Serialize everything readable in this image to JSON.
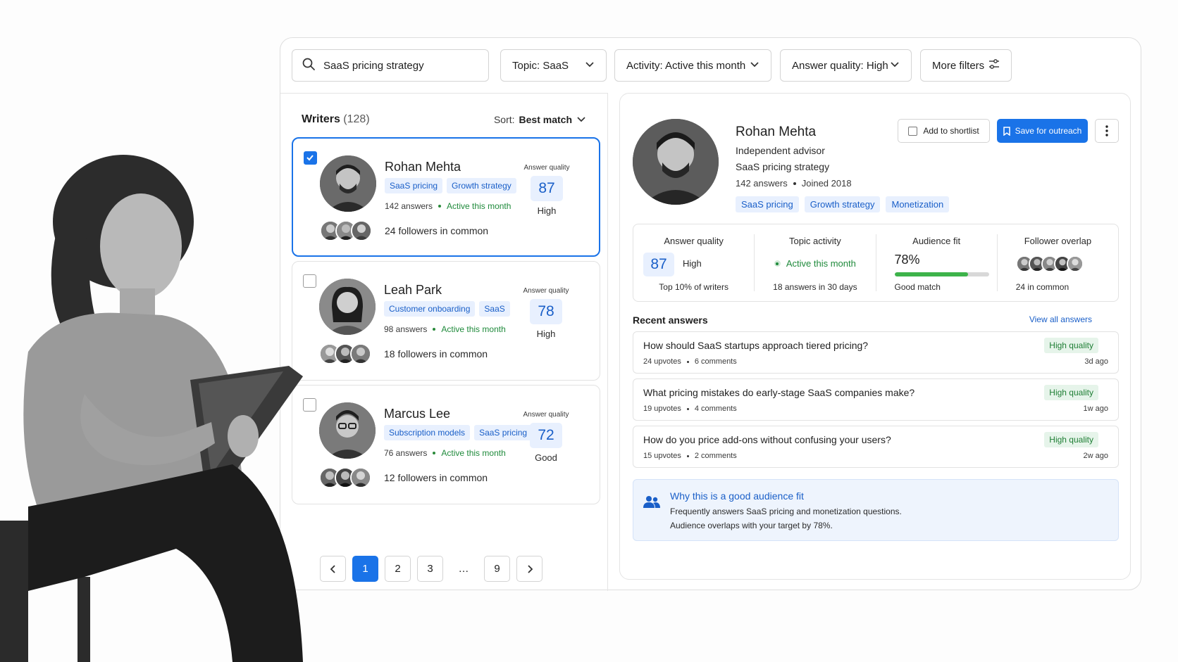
{
  "search": {
    "value": "SaaS pricing strategy"
  },
  "filters": [
    {
      "label": "Topic: SaaS"
    },
    {
      "label": "Activity: Active this month"
    },
    {
      "label": "Answer quality: High"
    },
    {
      "label": "More filters"
    }
  ],
  "writers": {
    "title": "Writers",
    "count": "(128)",
    "sort_prefix": "Sort:",
    "sort_value": "Best match",
    "cards": [
      {
        "name": "Rohan Mehta",
        "tags": [
          "SaaS pricing",
          "Growth strategy"
        ],
        "answers": "142 answers",
        "activity": "Active this month",
        "followers": "24 followers in common",
        "aq_label": "Answer quality",
        "aq_score": "87",
        "aq_level": "High",
        "selected": true
      },
      {
        "name": "Leah Park",
        "tags": [
          "Customer onboarding",
          "SaaS"
        ],
        "answers": "98 answers",
        "activity": "Active this month",
        "followers": "18  followers in common",
        "aq_label": "Answer quality",
        "aq_score": "78",
        "aq_level": "High",
        "selected": false
      },
      {
        "name": "Marcus Lee",
        "tags": [
          "Subscription models",
          "SaaS pricing"
        ],
        "answers": "76 answers",
        "activity": "Active this month",
        "followers": "12  followers in common",
        "aq_label": "Answer quality",
        "aq_score": "72",
        "aq_level": "Good",
        "selected": false
      }
    ]
  },
  "pagination": {
    "pages": [
      "1",
      "2",
      "3",
      "…",
      "9"
    ],
    "current": "1"
  },
  "detail": {
    "name": "Rohan Mehta",
    "role": "Independent advisor",
    "topic": "SaaS pricing strategy",
    "answers": "142 answers",
    "joined": "Joined 2018",
    "tags": [
      "SaaS pricing",
      "Growth strategy",
      "Monetization"
    ],
    "shortlist_label": "Add to shortlist",
    "save_label": "Save for outreach",
    "metrics": {
      "quality": {
        "label": "Answer quality",
        "score": "87",
        "level": "High",
        "foot": "Top 10% of writers"
      },
      "activity": {
        "label": "Topic activity",
        "status": "Active this month",
        "foot": "18 answers in 30 days"
      },
      "fit": {
        "label": "Audience fit",
        "percent_text": "78%",
        "value": 0.78,
        "foot": "Good match"
      },
      "overlap": {
        "label": "Follower overlap",
        "foot": "24 in common"
      }
    },
    "recent_title": "Recent answers",
    "view_all": "View all answers",
    "answers_list": [
      {
        "question": "How should SaaS startups approach tiered pricing?",
        "upvotes": "24 upvotes",
        "comments": "6 comments",
        "badge": "High quality",
        "age": "3d ago"
      },
      {
        "question": "What pricing mistakes do early-stage SaaS companies make?",
        "upvotes": "19 upvotes",
        "comments": "4 comments",
        "badge": "High quality",
        "age": "1w ago"
      },
      {
        "question": "How do you price add-ons without confusing your users?",
        "upvotes": "15 upvotes",
        "comments": "2 comments",
        "badge": "High quality",
        "age": "2w ago"
      }
    ],
    "fit_box": {
      "title": "Why this is a good audience fit",
      "line1": "Frequently answers SaaS pricing and monetization questions.",
      "line2": "Audience overlaps with your target by 78%."
    }
  },
  "colors": {
    "accent": "#1a73e8",
    "tag_bg": "#e8f0fe",
    "success": "#1f8a3b",
    "bar": "#3db34a"
  },
  "icons": [
    "search-icon",
    "chevron-down-icon",
    "sliders-icon",
    "check-icon",
    "bookmark-icon",
    "more-vertical-icon",
    "chevron-left-icon",
    "chevron-right-icon",
    "people-icon"
  ]
}
